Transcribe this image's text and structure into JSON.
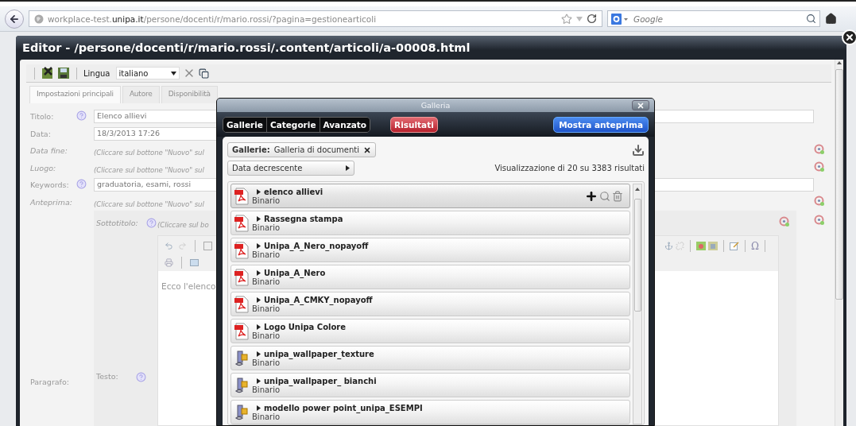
{
  "browser": {
    "url": "workplace-test.**unipa.it**/persone/docenti/r/mario.rossi/?pagina=gestionearticoli",
    "search_placeholder": "Google"
  },
  "editor": {
    "title": "Editor - /persone/docenti/r/mario.rossi/.content/articoli/a-00008.html",
    "toolbar": {
      "language_label": "Lingua",
      "language": "italiano"
    },
    "tabs": [
      {
        "label": "Impostazioni principali",
        "selected": true
      },
      {
        "label": "Autore",
        "selected": false
      },
      {
        "label": "Disponibilità",
        "selected": false
      }
    ],
    "fields": [
      {
        "label": "Titolo:",
        "kind": "input",
        "help": true,
        "value": "Elenco allievi"
      },
      {
        "label": "Data:",
        "kind": "date",
        "help": false,
        "value": "18/3/2013 17:26"
      },
      {
        "label": "Data fine:",
        "kind": "empty",
        "help": false,
        "value": "(Cliccare sul bottone \"Nuovo\" sul"
      },
      {
        "label": "Luogo:",
        "kind": "empty",
        "help": false,
        "value": "(Cliccare sul bottone \"Nuovo\" sul"
      },
      {
        "label": "Keywords:",
        "kind": "input",
        "help": true,
        "value": "graduatoria, esami, rossi"
      },
      {
        "label": "Anteprima:",
        "kind": "empty",
        "help": false,
        "value": "(Cliccare sul bottone \"Nuovo\" sul"
      }
    ],
    "paragraph": {
      "label": "Paragrafo:",
      "subtitle_label": "Sottotitolo:",
      "subtitle_help": true,
      "subtitle_value": "(Cliccare sul bo",
      "text_label": "Testo:",
      "text_help": true,
      "special_char": "Ω",
      "content": "Ecco l'elenco"
    }
  },
  "gallery": {
    "title": "Galleria",
    "tabs": [
      {
        "label": "Gallerie",
        "selected": false
      },
      {
        "label": "Categorie",
        "selected": false
      },
      {
        "label": "Avanzato",
        "selected": false
      }
    ],
    "results_button": "Risultati",
    "preview_button": "Mostra anteprima",
    "filter": {
      "name": "Gallerie:",
      "value": "Galleria di documenti"
    },
    "sort": "Data decrescente",
    "count": "Visualizzazione di 20 su 3383 risultati",
    "items": [
      {
        "name": "elenco allievi",
        "type": "Binario",
        "kind": "pdf",
        "hovered": true
      },
      {
        "name": "Rassegna stampa",
        "type": "Binario",
        "kind": "pdf",
        "hovered": false
      },
      {
        "name": "Unipa_A_Nero_nopayoff",
        "type": "Binario",
        "kind": "pdf",
        "hovered": false
      },
      {
        "name": "Unipa_A_Nero",
        "type": "Binario",
        "kind": "pdf",
        "hovered": false
      },
      {
        "name": "Unipa_A_CMKY_nopayoff",
        "type": "Binario",
        "kind": "pdf",
        "hovered": false
      },
      {
        "name": "Logo Unipa Colore",
        "type": "Binario",
        "kind": "pdf",
        "hovered": false
      },
      {
        "name": "unipa_wallpaper_texture",
        "type": "Binario",
        "kind": "binary",
        "hovered": false
      },
      {
        "name": "unipa_wallpaper_ bianchi",
        "type": "Binario",
        "kind": "binary",
        "hovered": false
      },
      {
        "name": "modello power point_unipa_ESEMPI",
        "type": "Binario",
        "kind": "binary",
        "hovered": false
      }
    ]
  }
}
